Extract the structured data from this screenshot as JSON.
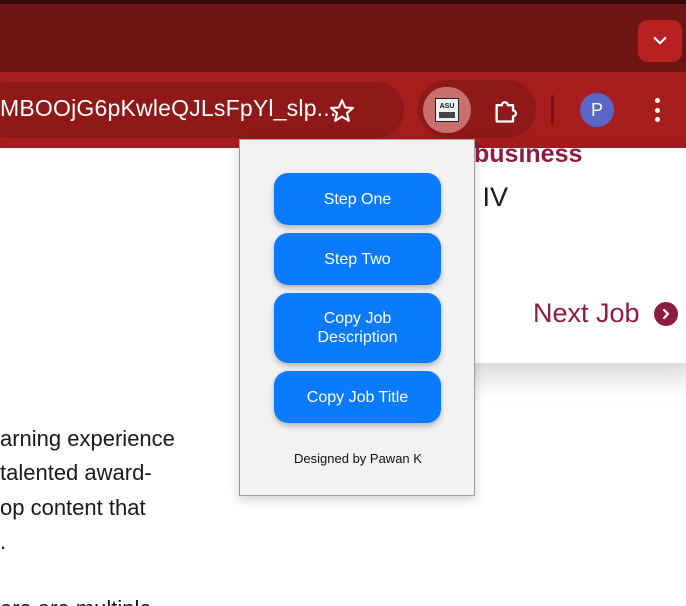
{
  "browser": {
    "url_display": "MBOOjG6pKwleQJLsFpYl_slp...",
    "profile_initial": "P"
  },
  "page": {
    "business_heading": "business",
    "job_level": "r IV",
    "next_job_label": "Next Job",
    "body_lines": [
      "arning experience",
      "talented award-",
      "op content that",
      ".",
      "ere are multiple"
    ]
  },
  "popup": {
    "buttons": [
      {
        "label": "Step One"
      },
      {
        "label": "Step Two"
      },
      {
        "label": "Copy Job Description"
      },
      {
        "label": "Copy Job Title"
      }
    ],
    "footer": "Designed by Pawan K"
  },
  "icons": {
    "tab_search": "chevron-down-icon",
    "bookmark": "star-icon",
    "extension_asu": "asu-extension-icon",
    "extensions_menu": "puzzle-icon",
    "browser_menu": "more-vertical-icon",
    "next_job": "chevron-right-circle-icon"
  },
  "colors": {
    "tabstrip": "#6e1414",
    "toolbar": "#a61d1d",
    "accent_maroon": "#8c1d40",
    "popup_button": "#0a7bff",
    "avatar": "#5a67c8"
  }
}
